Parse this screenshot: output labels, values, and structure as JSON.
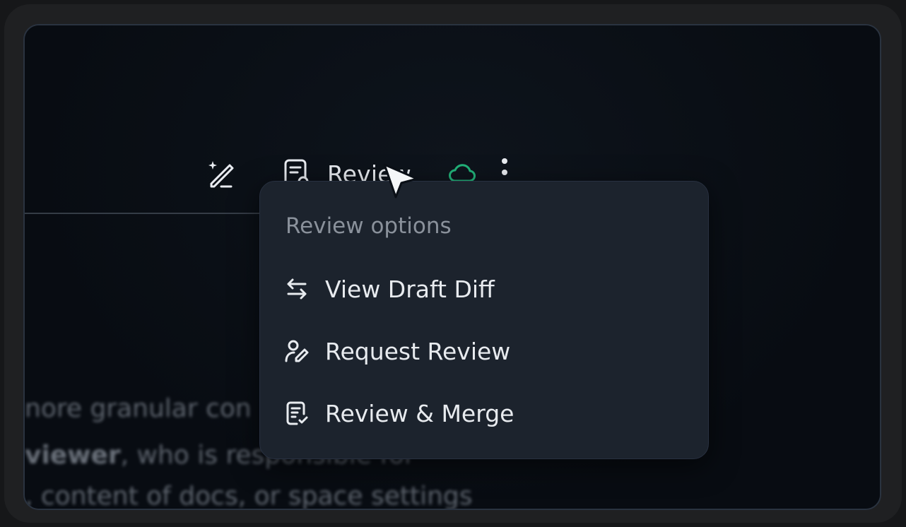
{
  "toolbar": {
    "ai_edit_icon": "wand-pencil-icon",
    "review_label": "Review",
    "review_icon": "document-search-icon",
    "cloud_icon": "cloud-icon",
    "cloud_color": "#22b37a",
    "more_icon": "vertical-ellipsis-icon"
  },
  "menu": {
    "title": "Review options",
    "items": [
      {
        "label": "View Draft Diff",
        "icon": "swap-arrows-icon"
      },
      {
        "label": "Request Review",
        "icon": "user-pencil-icon"
      },
      {
        "label": "Review & Merge",
        "icon": "document-check-icon"
      }
    ]
  },
  "background_text": {
    "line1": "nore granular con",
    "line2_bold": "viewer",
    "line2_rest": ", who is responsible for",
    "line3": ", content of docs, or space settings"
  }
}
